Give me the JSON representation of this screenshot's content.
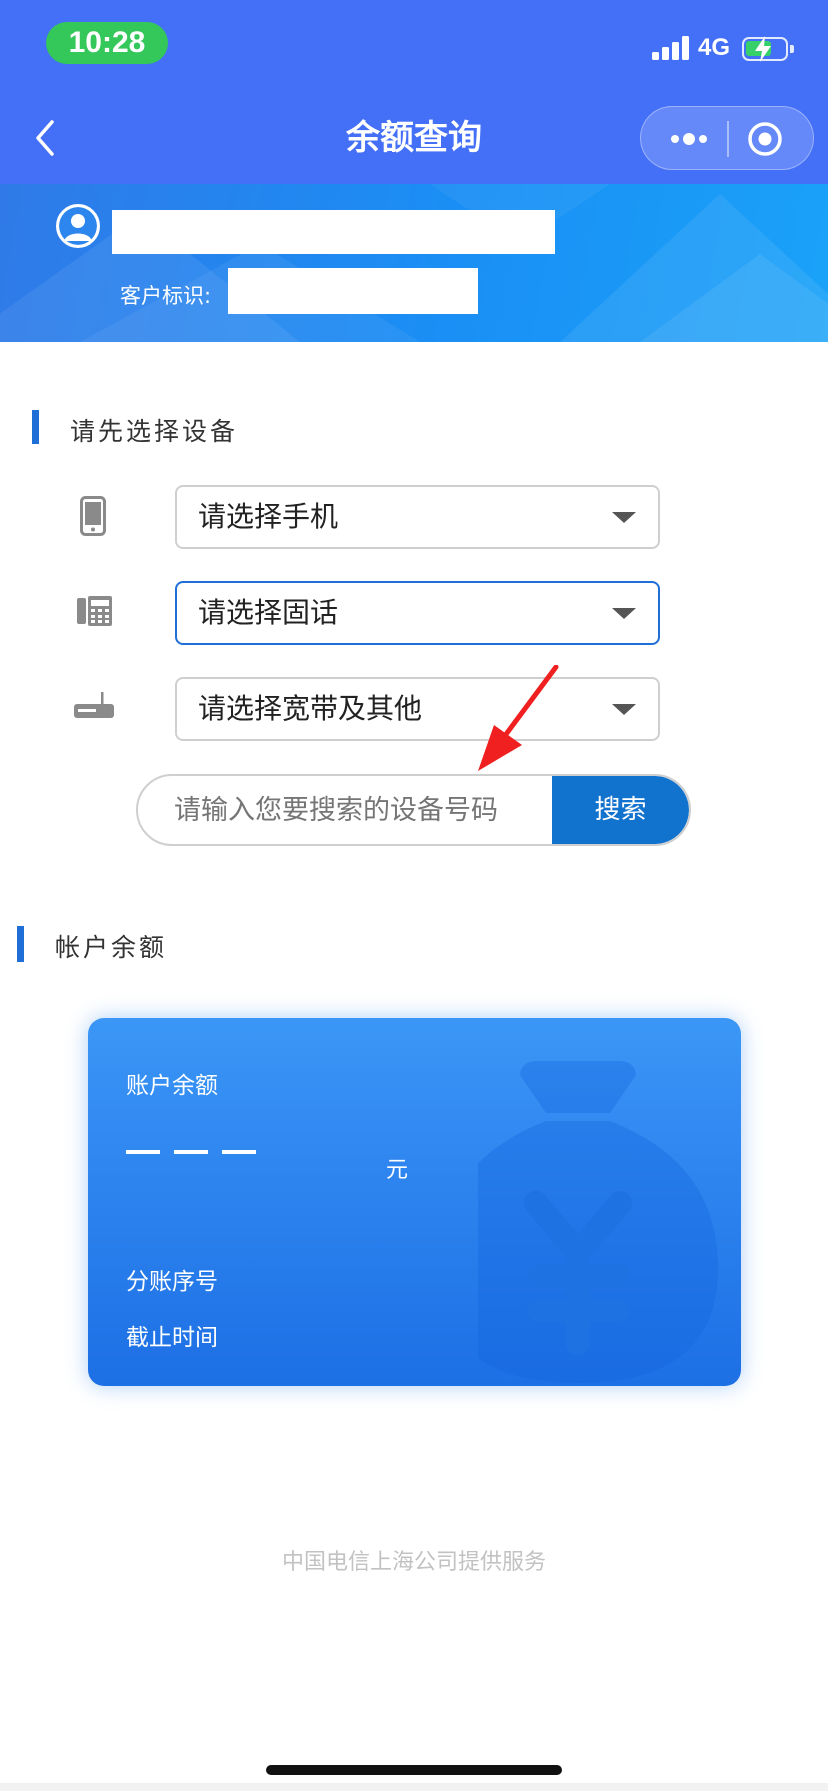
{
  "status_bar": {
    "time": "10:28",
    "network": "4G"
  },
  "nav": {
    "title": "余额查询"
  },
  "user": {
    "customer_id_label": "客户标识:"
  },
  "device_section": {
    "title": "请先选择设备",
    "selects": [
      {
        "label": "请选择手机",
        "icon": "mobile-phone-icon"
      },
      {
        "label": "请选择固话",
        "icon": "landline-phone-icon"
      },
      {
        "label": "请选择宽带及其他",
        "icon": "router-icon"
      }
    ],
    "search": {
      "placeholder": "请输入您要搜索的设备号码",
      "button": "搜索"
    }
  },
  "balance_section": {
    "title": "帐户余额",
    "card": {
      "label": "账户余额",
      "amount": "— — —",
      "unit": "元",
      "sub_account_label": "分账序号",
      "deadline_label": "截止时间"
    }
  },
  "footer": {
    "text": "中国电信上海公司提供服务"
  },
  "colors": {
    "nav_bg": "#4470f7",
    "accent": "#1273cf",
    "annotation_arrow": "#f02020"
  }
}
